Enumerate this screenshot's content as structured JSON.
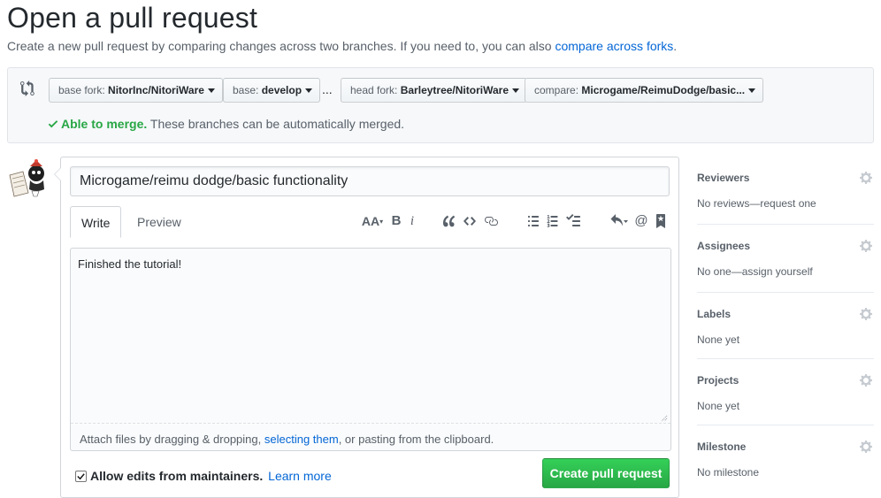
{
  "page": {
    "title": "Open a pull request",
    "subtitle": "Create a new pull request by comparing changes across two branches. If you need to, you can also",
    "subtitle_link": "compare across forks",
    "subtitle_end": "."
  },
  "range": {
    "base_fork_key": "base fork:",
    "base_fork_value": "NitorInc/NitoriWare",
    "base_key": "base:",
    "base_value": "develop",
    "separator": "...",
    "head_fork_key": "head fork:",
    "head_fork_value": "Barleytree/NitoriWare",
    "compare_key": "compare:",
    "compare_value": "Microgame/ReimuDodge/basic...",
    "merge_status": "Able to merge.",
    "merge_detail": "These branches can be automatically merged.",
    "merge_color": "#28a745"
  },
  "editor": {
    "title_value": "Microgame/reimu dodge/basic functionality",
    "tab_write": "Write",
    "tab_preview": "Preview",
    "body_value": "Finished the tutorial!",
    "attach_text_1": "Attach files by dragging & dropping,",
    "attach_link": "selecting them",
    "attach_text_2": ", or pasting from the clipboard.",
    "toolbar": {
      "header": "AA",
      "bold": "B",
      "italic": "i",
      "mention": "@"
    }
  },
  "footer": {
    "allow_edits_label": "Allow edits from maintainers.",
    "allow_edits_checked": true,
    "learn_more": "Learn more",
    "create_button": "Create pull request",
    "button_color": "#28a745"
  },
  "sidebar": {
    "sections": [
      {
        "heading": "Reviewers",
        "value": "No reviews—request one"
      },
      {
        "heading": "Assignees",
        "value": "No one—assign yourself"
      },
      {
        "heading": "Labels",
        "value": "None yet"
      },
      {
        "heading": "Projects",
        "value": "None yet"
      },
      {
        "heading": "Milestone",
        "value": "No milestone"
      }
    ]
  },
  "colors": {
    "link": "#0366d6",
    "text": "#24292e",
    "muted": "#586069"
  }
}
